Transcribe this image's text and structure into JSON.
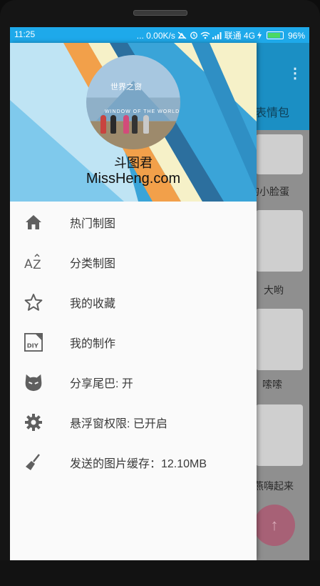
{
  "status_bar": {
    "time": "11:25",
    "dots": "...",
    "speed": "0.00K/s",
    "carrier": "联通",
    "network": "4G",
    "battery": "96%",
    "battery_level": 0.96
  },
  "background_app": {
    "tab_label": "表情包",
    "captions": [
      "的小脸蛋",
      "大哟",
      "嗦嗦",
      "燕嗨起来"
    ]
  },
  "drawer": {
    "header": {
      "name": "斗图君",
      "site": "MissHeng.com",
      "avatar_sign": "世界之窗",
      "avatar_text": "WINDOW OF THE WORLD"
    },
    "items": [
      {
        "icon": "home-icon",
        "label": "热门制图"
      },
      {
        "icon": "sort-az-icon",
        "label": "分类制图"
      },
      {
        "icon": "star-outline-icon",
        "label": "我的收藏"
      },
      {
        "icon": "diy-icon",
        "label": "我的制作"
      },
      {
        "icon": "cat-face-icon",
        "label": "分享尾巴: 开"
      },
      {
        "icon": "gear-icon",
        "label": "悬浮窗权限: 已开启"
      },
      {
        "icon": "broom-icon",
        "label": "发送的图片缓存：12.10MB"
      }
    ]
  },
  "colors": {
    "status_bar": "#1ea9ea",
    "toolbar": "#1b8fc4",
    "fab": "#a76176"
  }
}
